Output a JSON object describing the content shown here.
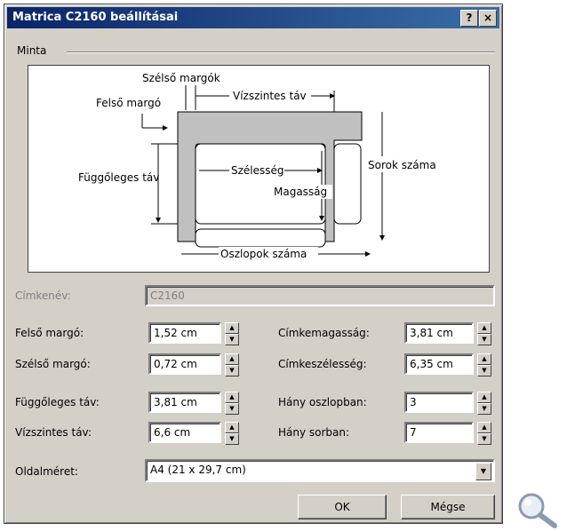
{
  "window": {
    "title": "Matrica C2160 beállításai",
    "help_label": "?",
    "close_label": "×"
  },
  "preview": {
    "group_label": "Minta",
    "labels": {
      "side_margin": "Szélső margók",
      "top_margin": "Felső margó",
      "horizontal_pitch": "Vízszintes táv",
      "vertical_pitch": "Függőleges táv",
      "width": "Szélesség",
      "height": "Magasság",
      "rows": "Sorok száma",
      "columns": "Oszlopok száma"
    }
  },
  "fields": {
    "label_name": {
      "label": "Címkenév:",
      "value": "C2160"
    },
    "top_margin": {
      "label": "Felső margó:",
      "value": "1,52 cm"
    },
    "side_margin": {
      "label": "Szélső margó:",
      "value": "0,72 cm"
    },
    "vertical_pitch": {
      "label": "Függőleges táv:",
      "value": "3,81 cm"
    },
    "horizontal_pitch": {
      "label": "Vízszintes táv:",
      "value": "6,6 cm"
    },
    "label_height": {
      "label": "Címkemagasság:",
      "value": "3,81 cm"
    },
    "label_width": {
      "label": "Címkeszélesség:",
      "value": "6,35 cm"
    },
    "number_across": {
      "label": "Hány oszlopban:",
      "value": "3"
    },
    "number_down": {
      "label": "Hány sorban:",
      "value": "7"
    },
    "page_size": {
      "label": "Oldalméret:",
      "value": "A4 (21 x 29,7 cm)"
    }
  },
  "buttons": {
    "ok": "OK",
    "cancel": "Mégse"
  },
  "icons": {
    "zoom": "magnifier-icon"
  }
}
